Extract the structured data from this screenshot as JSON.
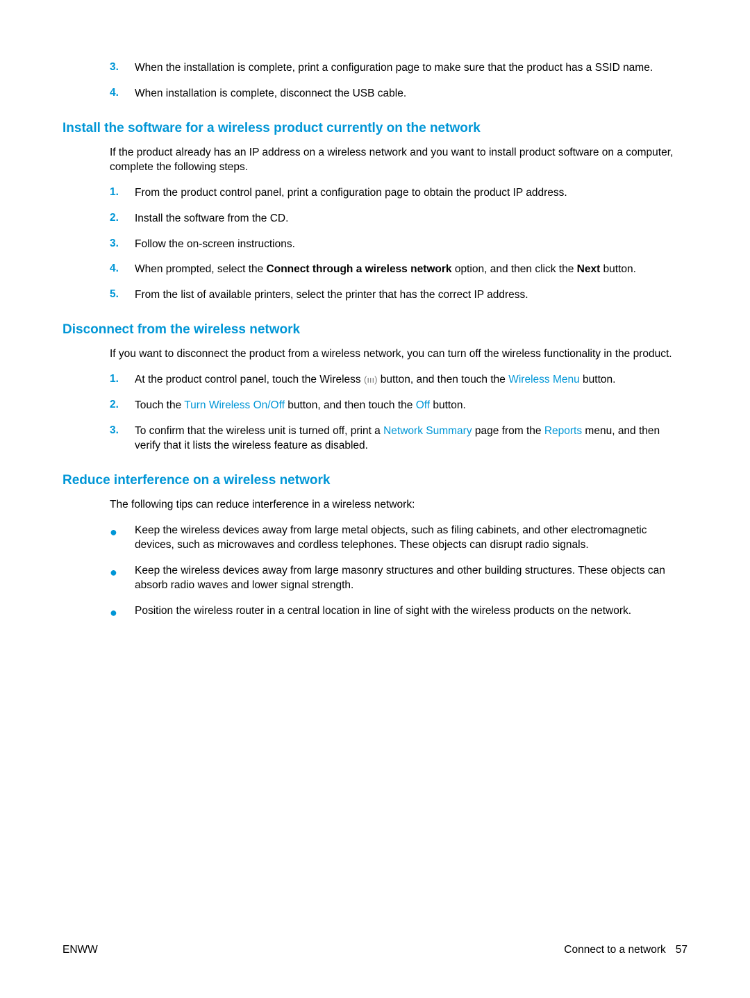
{
  "top_steps": [
    {
      "n": "3.",
      "text": "When the installation is complete, print a configuration page to make sure that the product has a SSID name."
    },
    {
      "n": "4.",
      "text": "When installation is complete, disconnect the USB cable."
    }
  ],
  "sec1": {
    "heading": "Install the software for a wireless product currently on the network",
    "intro": "If the product already has an IP address on a wireless network and you want to install product software on a computer, complete the following steps.",
    "steps": [
      {
        "n": "1.",
        "text": "From the product control panel, print a configuration page to obtain the product IP address."
      },
      {
        "n": "2.",
        "text": "Install the software from the CD."
      },
      {
        "n": "3.",
        "text": "Follow the on-screen instructions."
      },
      {
        "n": "4.",
        "pre": "When prompted, select the ",
        "bold1": "Connect through a wireless network",
        "mid": " option, and then click the ",
        "bold2": "Next",
        "post": " button."
      },
      {
        "n": "5.",
        "text": "From the list of available printers, select the printer that has the correct IP address."
      }
    ]
  },
  "sec2": {
    "heading": "Disconnect from the wireless network",
    "intro": "If you want to disconnect the product from a wireless network, you can turn off the wireless functionality in the product.",
    "steps": {
      "s1": {
        "n": "1.",
        "pre": "At the product control panel, touch the Wireless ",
        "post1": " button, and then touch the ",
        "ui1": "Wireless Menu",
        "post2": " button."
      },
      "s2": {
        "n": "2.",
        "pre": "Touch the ",
        "ui1": "Turn Wireless On/Off",
        "mid": " button, and then touch the ",
        "ui2": "Off",
        "post": " button."
      },
      "s3": {
        "n": "3.",
        "pre": "To confirm that the wireless unit is turned off, print a ",
        "ui1": "Network Summary",
        "mid": " page from the ",
        "ui2": "Reports",
        "post": " menu, and then verify that it lists the wireless feature as disabled."
      }
    }
  },
  "sec3": {
    "heading": "Reduce interference on a wireless network",
    "intro": "The following tips can reduce interference in a wireless network:",
    "bullets": [
      "Keep the wireless devices away from large metal objects, such as filing cabinets, and other electromagnetic devices, such as microwaves and cordless telephones. These objects can disrupt radio signals.",
      "Keep the wireless devices away from large masonry structures and other building structures. These objects can absorb radio waves and lower signal strength.",
      "Position the wireless router in a central location in line of sight with the wireless products on the network."
    ]
  },
  "footer": {
    "left": "ENWW",
    "right": "Connect to a network",
    "page": "57"
  }
}
